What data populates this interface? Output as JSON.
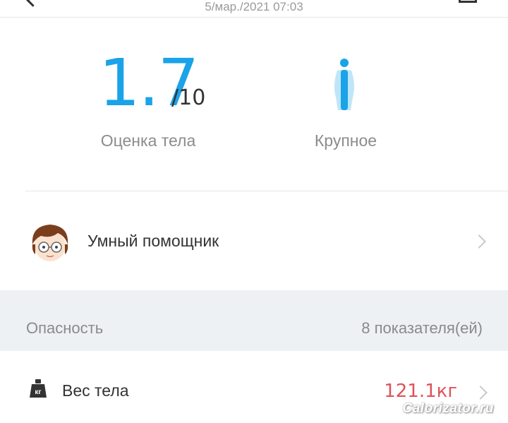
{
  "header": {
    "datetime": "5/мар./2021 07:03"
  },
  "summary": {
    "score_value": "1.7",
    "score_max": "/10",
    "score_label": "Оценка тела",
    "body_type": "Крупное",
    "body_icon": "body-figure-icon",
    "accent_color": "#1aa3e8"
  },
  "assistant": {
    "label": "Умный помощник",
    "avatar_icon": "assistant-avatar"
  },
  "risk_section": {
    "title": "Опасность",
    "count": "8 показателя(ей)"
  },
  "metrics": [
    {
      "label": "Вес тела",
      "value": "121.1кг",
      "icon": "weight-kg-icon",
      "value_color": "#e0525a"
    }
  ],
  "watermark": "Calorizator.ru"
}
